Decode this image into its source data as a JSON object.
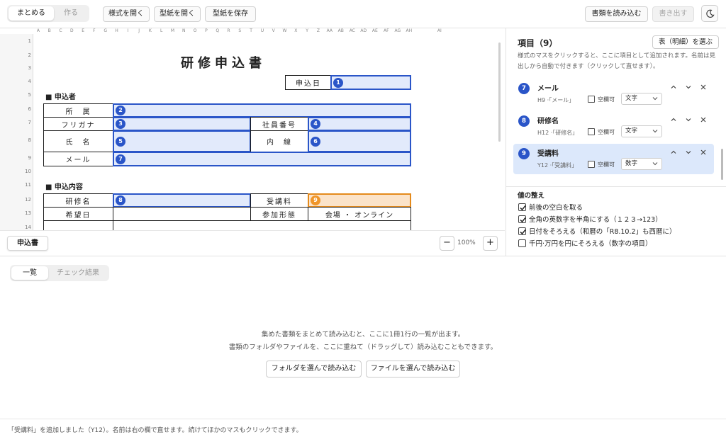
{
  "toolbar": {
    "mode_summary": "まとめる",
    "mode_create": "作る",
    "open_style": "様式を開く",
    "open_template": "型紙を開く",
    "save_template": "型紙を保存",
    "load_documents": "書類を読み込む",
    "export": "書き出す"
  },
  "sheet": {
    "columns": [
      "A",
      "B",
      "C",
      "D",
      "E",
      "F",
      "G",
      "H",
      "I",
      "J",
      "K",
      "L",
      "M",
      "N",
      "O",
      "P",
      "Q",
      "R",
      "S",
      "T",
      "U",
      "V",
      "W",
      "X",
      "Y",
      "Z",
      "AA",
      "AB",
      "AC",
      "AD",
      "AE",
      "AF",
      "AG",
      "AH",
      "AI"
    ],
    "rows": [
      "1",
      "2",
      "3",
      "4",
      "5",
      "6",
      "7",
      "8",
      "9",
      "10",
      "11",
      "12",
      "13",
      "14"
    ],
    "title": "研修申込書",
    "section_applicant": "■ 申込者",
    "section_content": "■ 申込内容",
    "label_date": "申込日",
    "label_dept": "所　属",
    "label_kana": "フリガナ",
    "label_empno": "社員番号",
    "label_name": "氏　名",
    "label_ext": "内　線",
    "label_mail": "メール",
    "label_course": "研修名",
    "label_fee": "受講料",
    "label_wishdate": "希望日",
    "label_format": "参加形態",
    "value_format": "会場 ・ オンライン",
    "badges": [
      "1",
      "2",
      "3",
      "4",
      "5",
      "6",
      "7",
      "8",
      "9"
    ]
  },
  "sheet_footer": {
    "tab": "申込書",
    "zoom": "100%",
    "zoom_out": "−",
    "zoom_in": "+"
  },
  "items_panel": {
    "title": "項目（9）",
    "pick_table": "表（明細）を選ぶ",
    "description": "様式のマスをクリックすると、ここに項目として追加されます。名前は見出しから自動で付きます（クリックして直せます）。",
    "items": [
      {
        "num": "7",
        "name": "メール",
        "ref": "H9 ·「メール」",
        "empty_ok": "空欄可",
        "type": "文字"
      },
      {
        "num": "8",
        "name": "研修名",
        "ref": "H12 ·「研修名」",
        "empty_ok": "空欄可",
        "type": "文字"
      },
      {
        "num": "9",
        "name": "受講料",
        "ref": "Y12 ·「受講料」",
        "empty_ok": "空欄可",
        "type": "数字"
      }
    ],
    "normalize_title": "値の整え",
    "normalize": [
      {
        "label": "前後の空白を取る",
        "checked": true
      },
      {
        "label": "全角の英数字を半角にする（１２３→123）",
        "checked": true
      },
      {
        "label": "日付をそろえる（和暦の「R8.10.2」も西暦に）",
        "checked": true
      },
      {
        "label": "千円·万円を円にそろえる（数字の項目）",
        "checked": false
      }
    ]
  },
  "lower": {
    "tab_list": "一覧",
    "tab_check": "チェック結果",
    "message1": "集めた書類をまとめて読み込むと、ここに1冊1行の一覧が出ます。",
    "message2": "書類のフォルダやファイルを、ここに重ねて（ドラッグして）読み込むこともできます。",
    "btn_folder": "フォルダを選んで読み込む",
    "btn_file": "ファイルを選んで読み込む"
  },
  "status": {
    "text": "「受講料」を追加しました（Y12）。名前は右の欄で直せます。続けてほかのマスもクリックできます。"
  }
}
